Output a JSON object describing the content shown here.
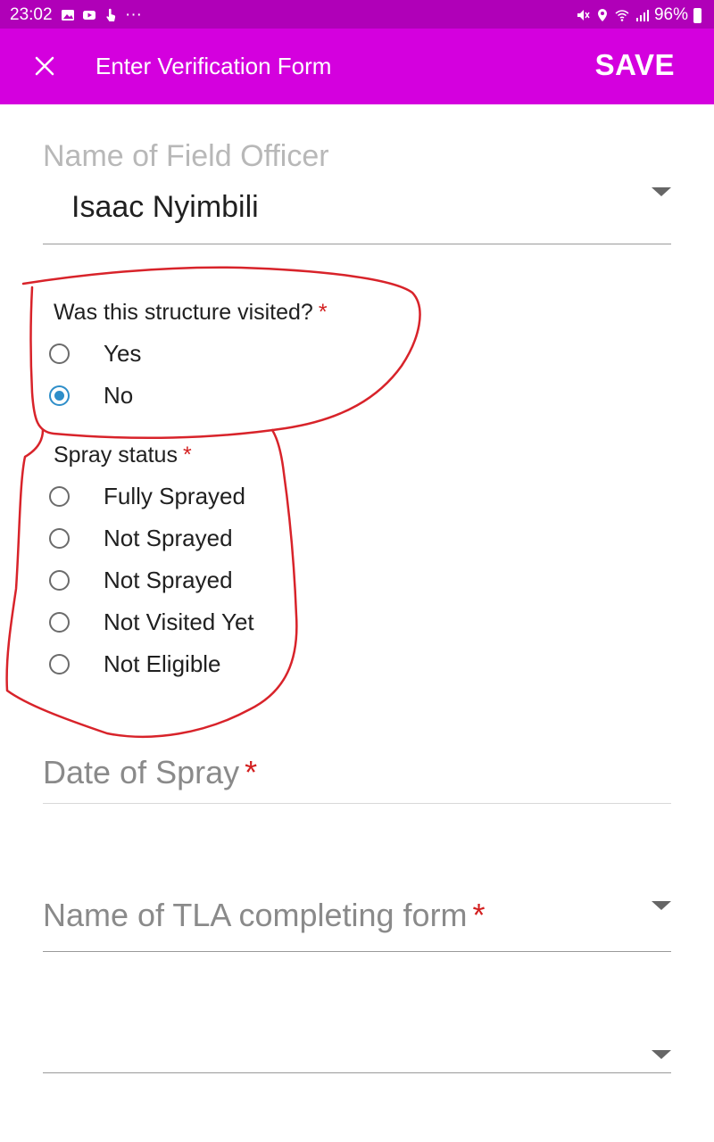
{
  "status_bar": {
    "time": "23:02",
    "more": "···",
    "battery_pct": "96%"
  },
  "app_bar": {
    "title": "Enter Verification Form",
    "save_label": "SAVE"
  },
  "field_officer": {
    "label": "Name of Field Officer",
    "value": "Isaac Nyimbili"
  },
  "visited": {
    "question": "Was this structure visited?",
    "required_mark": "*",
    "options": [
      {
        "label": "Yes",
        "selected": false
      },
      {
        "label": "No",
        "selected": true
      }
    ]
  },
  "spray_status": {
    "question": "Spray status",
    "required_mark": "*",
    "options": [
      {
        "label": "Fully Sprayed",
        "selected": false
      },
      {
        "label": "Not Sprayed",
        "selected": false
      },
      {
        "label": "Not Sprayed",
        "selected": false
      },
      {
        "label": "Not Visited Yet",
        "selected": false
      },
      {
        "label": "Not Eligible",
        "selected": false
      }
    ]
  },
  "date_of_spray": {
    "label": "Date of Spray",
    "required_mark": "*"
  },
  "tla_name": {
    "label": "Name of TLA completing form",
    "required_mark": "*"
  },
  "colors": {
    "status_bar": "#b000b8",
    "app_bar": "#d400de",
    "radio_selected": "#2e8ec9",
    "required": "#d32020",
    "annotation": "#d8232a"
  }
}
